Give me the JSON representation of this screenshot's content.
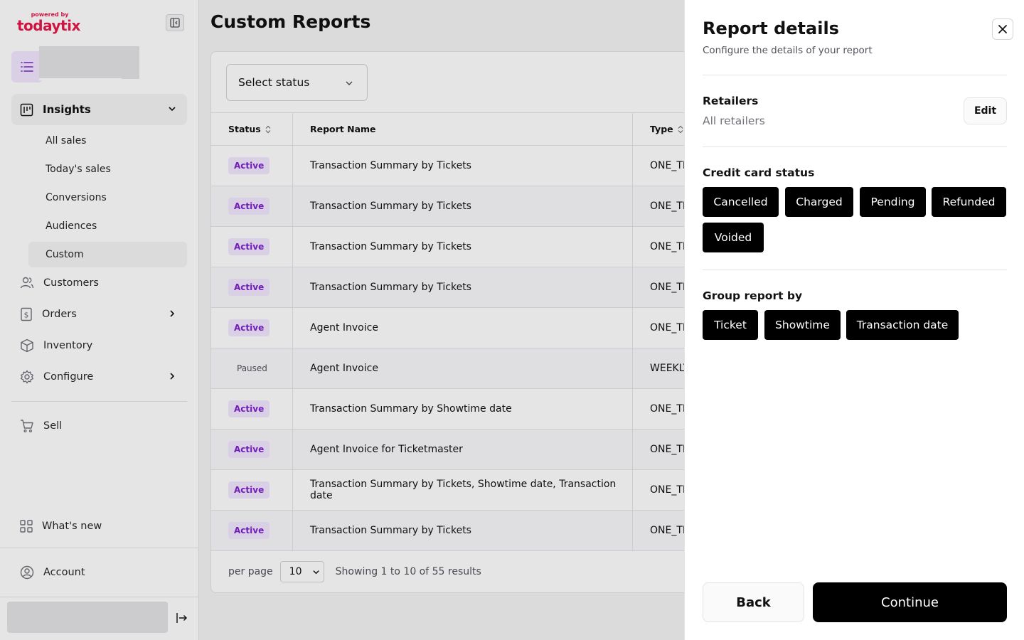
{
  "brand": {
    "powered_by": "powered by",
    "name": "todaytix",
    "color": "#e8174a"
  },
  "sidebar": {
    "insights_label": "Insights",
    "insights_sub": [
      {
        "label": "All sales",
        "active": false
      },
      {
        "label": "Today's sales",
        "active": false
      },
      {
        "label": "Conversions",
        "active": false
      },
      {
        "label": "Audiences",
        "active": false
      },
      {
        "label": "Custom",
        "active": true
      }
    ],
    "items": [
      {
        "label": "Customers",
        "icon": "users-icon",
        "chevron": false
      },
      {
        "label": "Orders",
        "icon": "dollar-receipt-icon",
        "chevron": true
      },
      {
        "label": "Inventory",
        "icon": "box-icon",
        "chevron": false
      },
      {
        "label": "Configure",
        "icon": "gear-icon",
        "chevron": true
      }
    ],
    "sell_label": "Sell",
    "whats_new_label": "What's new",
    "account_label": "Account"
  },
  "main": {
    "page_title": "Custom Reports",
    "status_select": "Select status",
    "columns": {
      "status": "Status",
      "name": "Report Name",
      "type": "Type"
    },
    "rows": [
      {
        "status": "Active",
        "name": "Transaction Summary by Tickets",
        "type": "ONE_TI"
      },
      {
        "status": "Active",
        "name": "Transaction Summary by Tickets",
        "type": "ONE_TI"
      },
      {
        "status": "Active",
        "name": "Transaction Summary by Tickets",
        "type": "ONE_TI"
      },
      {
        "status": "Active",
        "name": "Transaction Summary by Tickets",
        "type": "ONE_TI"
      },
      {
        "status": "Active",
        "name": "Agent Invoice",
        "type": "ONE_TI"
      },
      {
        "status": "Paused",
        "name": "Agent Invoice",
        "type": "WEEKLY"
      },
      {
        "status": "Active",
        "name": "Transaction Summary by Showtime date",
        "type": "ONE_TI"
      },
      {
        "status": "Active",
        "name": "Agent Invoice for Ticketmaster",
        "type": "ONE_TI"
      },
      {
        "status": "Active",
        "name": "Transaction Summary by Tickets, Showtime date, Transaction date",
        "type": "ONE_TI"
      },
      {
        "status": "Active",
        "name": "Transaction Summary by Tickets",
        "type": "ONE_TI"
      }
    ],
    "footer": {
      "per_page_label": "per page",
      "per_page_value": "10",
      "showing": "Showing 1 to 10 of 55 results"
    }
  },
  "drawer": {
    "title": "Report details",
    "subtitle": "Configure the details of your report",
    "retailers_label": "Retailers",
    "retailers_value": "All retailers",
    "edit_label": "Edit",
    "cc_label": "Credit card status",
    "cc_chips": [
      "Cancelled",
      "Charged",
      "Pending",
      "Refunded",
      "Voided"
    ],
    "group_label": "Group report by",
    "group_chips": [
      "Ticket",
      "Showtime",
      "Transaction date"
    ],
    "back_label": "Back",
    "continue_label": "Continue"
  },
  "colors": {
    "accent": "#7e22ce",
    "accent_bg": "#f3e8ff",
    "chip": "#000000"
  }
}
